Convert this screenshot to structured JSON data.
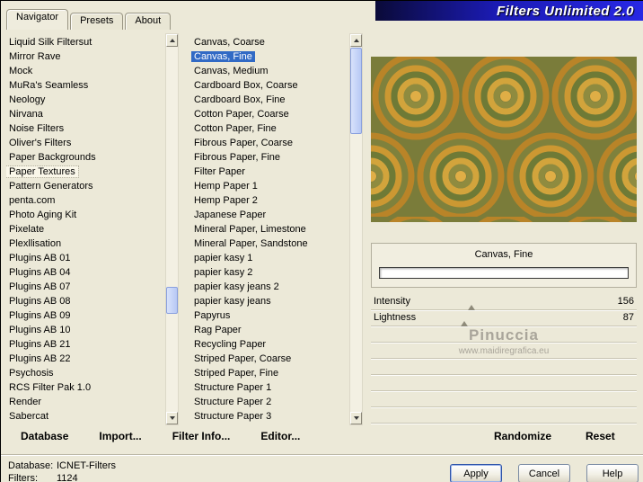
{
  "window": {
    "banner_title": "Filters Unlimited 2.0",
    "tabs": [
      "Navigator",
      "Presets",
      "About"
    ],
    "active_tab": "Navigator"
  },
  "navigator": {
    "items": [
      "Liquid Silk Filtersut",
      "Mirror Rave",
      "Mock",
      "MuRa's Seamless",
      "Neology",
      "Nirvana",
      "Noise Filters",
      "Oliver's Filters",
      "Paper Backgrounds",
      "Paper Textures",
      "Pattern Generators",
      "penta.com",
      "Photo Aging Kit",
      "Pixelate",
      "Plexllisation",
      "Plugins AB 01",
      "Plugins AB 04",
      "Plugins AB 07",
      "Plugins AB 08",
      "Plugins AB 09",
      "Plugins AB 10",
      "Plugins AB 21",
      "Plugins AB 22",
      "Psychosis",
      "RCS Filter Pak 1.0",
      "Render",
      "Sabercat"
    ],
    "selected_index": 9
  },
  "filters": {
    "items": [
      "Canvas, Coarse",
      "Canvas, Fine",
      "Canvas, Medium",
      "Cardboard Box, Coarse",
      "Cardboard Box, Fine",
      "Cotton Paper, Coarse",
      "Cotton Paper, Fine",
      "Fibrous Paper, Coarse",
      "Fibrous Paper, Fine",
      "Filter Paper",
      "Hemp Paper 1",
      "Hemp Paper 2",
      "Japanese Paper",
      "Mineral Paper, Limestone",
      "Mineral Paper, Sandstone",
      "papier kasy 1",
      "papier kasy 2",
      "papier kasy jeans 2",
      "papier kasy jeans",
      "Papyrus",
      "Rag Paper",
      "Recycling Paper",
      "Striped Paper, Coarse",
      "Striped Paper, Fine",
      "Structure Paper 1",
      "Structure Paper 2",
      "Structure Paper 3"
    ],
    "selected_index": 1
  },
  "preview": {
    "selected_filter_name": "Canvas, Fine",
    "params": [
      {
        "name": "Intensity",
        "value": "156",
        "slider_percent": 38
      },
      {
        "name": "Lightness",
        "value": "87",
        "slider_percent": 35
      }
    ],
    "empty_param_rows": 6,
    "watermark": {
      "line1": "Pinuccia",
      "line2": "www.maidiregrafica.eu"
    },
    "randomize_label": "Randomize",
    "reset_label": "Reset"
  },
  "toolbar": {
    "items": [
      "Database",
      "Import...",
      "Filter Info...",
      "Editor..."
    ]
  },
  "statusbar": {
    "db_label": "Database:",
    "db_value": "ICNET-Filters",
    "filters_label": "Filters:",
    "filters_value": "1124"
  },
  "actions": {
    "apply": "Apply",
    "cancel": "Cancel",
    "help": "Help"
  },
  "colors": {
    "dialog_beige": "#ece9d8",
    "selection_blue": "#316ac5",
    "banner_blue": "#1b1bb4",
    "swirl_orange": "#c9862c",
    "swirl_olive": "#7a7c3a"
  }
}
